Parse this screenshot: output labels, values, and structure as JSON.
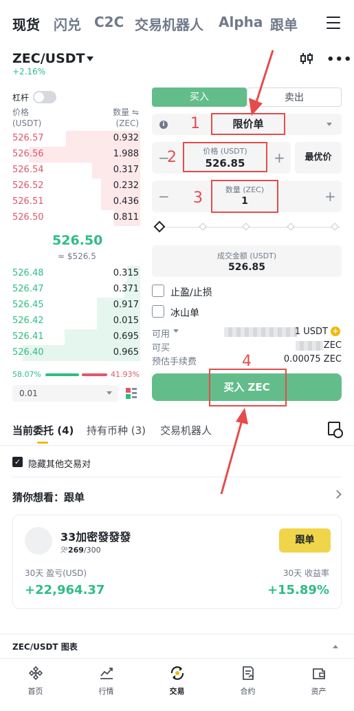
{
  "top_tabs": [
    "现货",
    "闪兑",
    "C2C",
    "交易机器人",
    "Alpha",
    "跟单"
  ],
  "pair": {
    "symbol": "ZEC/USDT",
    "change": "+2.16%"
  },
  "leverage_label": "杠杆",
  "orderbook": {
    "price_header": "价格",
    "price_unit": "(USDT)",
    "qty_header": "数量 ⇋",
    "qty_unit": "(ZEC)",
    "asks": [
      {
        "price": "526.57",
        "qty": "0.932",
        "depth": 0.57
      },
      {
        "price": "526.56",
        "qty": "1.988",
        "depth": 0.85
      },
      {
        "price": "526.54",
        "qty": "0.317",
        "depth": 0.37
      },
      {
        "price": "526.52",
        "qty": "0.232",
        "depth": 0.3
      },
      {
        "price": "526.51",
        "qty": "0.436",
        "depth": 0.3
      },
      {
        "price": "526.50",
        "qty": "0.811",
        "depth": 0.2
      }
    ],
    "mid_price": "526.50",
    "mid_usd": "≈ $526.5",
    "bids": [
      {
        "price": "526.48",
        "qty": "0.315",
        "depth": 0.1
      },
      {
        "price": "526.47",
        "qty": "0.371",
        "depth": 0.12
      },
      {
        "price": "526.45",
        "qty": "0.917",
        "depth": 0.33
      },
      {
        "price": "526.42",
        "qty": "0.015",
        "depth": 0.33
      },
      {
        "price": "526.41",
        "qty": "0.695",
        "depth": 0.58
      },
      {
        "price": "526.40",
        "qty": "0.965",
        "depth": 0.9
      }
    ],
    "buy_ratio": "58.07%",
    "sell_ratio": "41.93%",
    "depth_step": "0.01"
  },
  "trade": {
    "buy_tab": "买入",
    "sell_tab": "卖出",
    "order_type": "限价单",
    "price_label": "价格 (USDT)",
    "price_value": "526.85",
    "best_price": "最优价",
    "qty_label": "数量 (ZEC)",
    "qty_value": "1",
    "total_label": "成交金额 (USDT)",
    "total_value": "526.85",
    "tp_sl": "止盈/止损",
    "iceberg": "冰山单",
    "available_label": "可用",
    "available_value": "1 USDT",
    "can_buy_label": "可买",
    "can_buy_value": "ZEC",
    "fee_label": "预估手续费",
    "fee_value": "0.00075 ZEC",
    "buy_button": "买入 ZEC",
    "minus": "−",
    "plus": "+"
  },
  "annotations": [
    "1",
    "2",
    "3",
    "4"
  ],
  "orders_tabs": [
    "当前委托 (4)",
    "持有币种 (3)",
    "交易机器人"
  ],
  "hide_others": "隐藏其他交易对",
  "guess": "猜你想看：跟单",
  "copy_card": {
    "name": "33加密發發發",
    "followers_current": "269",
    "followers_max": "/300",
    "pnl_label": "30天 盈亏(USD)",
    "pnl_value": "+22,964.37",
    "roi_label": "30天 收益率",
    "roi_value": "+15.89%",
    "follow_button": "跟单"
  },
  "chart_section": "ZEC/USDT 图表",
  "bottom_nav": [
    {
      "label": "首页",
      "icon": "home-icon"
    },
    {
      "label": "行情",
      "icon": "markets-icon"
    },
    {
      "label": "交易",
      "icon": "trade-icon"
    },
    {
      "label": "合约",
      "icon": "futures-icon"
    },
    {
      "label": "资产",
      "icon": "wallet-icon"
    }
  ],
  "colors": {
    "buy_green": "#63bd8b",
    "up_green": "#2ebd85",
    "down_red": "#e0566b",
    "annotation_red": "#e64b4b",
    "brand_yellow": "#f0b90b"
  }
}
